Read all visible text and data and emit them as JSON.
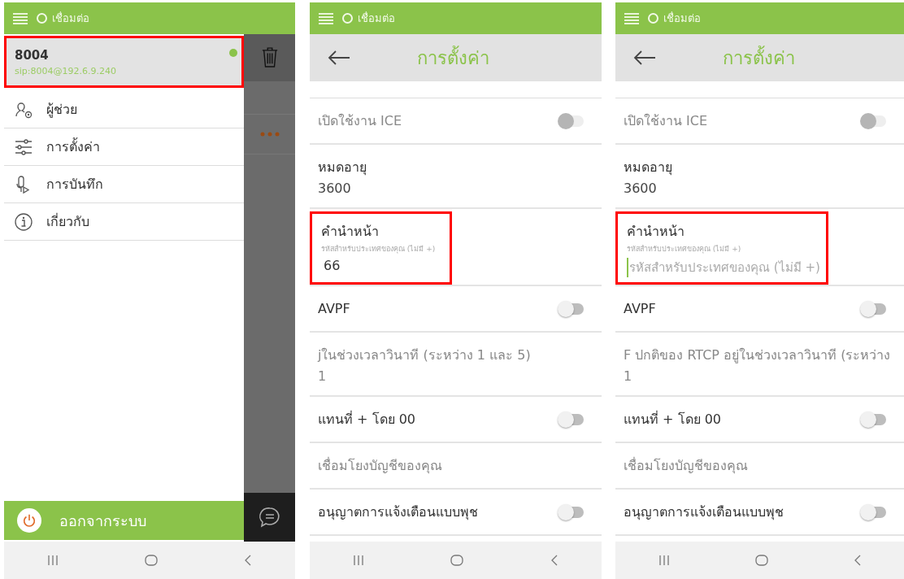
{
  "panels": [
    {
      "kind": "drawer",
      "status": {
        "label": "เชื่อมต่อ",
        "connected": true
      },
      "account": {
        "name": "8004",
        "address": "sip:8004@192.6.9.240",
        "online": true,
        "highlighted": true
      },
      "menu": [
        {
          "kind": "assistant",
          "label": "ผู้ช่วย"
        },
        {
          "kind": "settings",
          "label": "การตั้งค่า"
        },
        {
          "kind": "recordings",
          "label": "การบันทึก"
        },
        {
          "kind": "about",
          "label": "เกี่ยวกับ"
        }
      ],
      "logout": {
        "label": "ออกจากระบบ"
      }
    },
    {
      "kind": "settings",
      "status": {
        "label": "เชื่อมต่อ",
        "connected": true
      },
      "title": "การตั้งค่า",
      "settings": [
        {
          "kind": "toggle",
          "label": "เปิดใช้งาน ICE",
          "on": false,
          "disabled": true
        },
        {
          "kind": "value",
          "label": "หมดอายุ",
          "value": "3600",
          "disabled": false
        },
        {
          "kind": "field",
          "label": "คำนำหน้า",
          "hint": "รหัสสำหรับประเทศของคุณ (ไม่มี +)",
          "value": "66",
          "highlighted": true,
          "focused": false
        },
        {
          "kind": "toggle",
          "label": "AVPF",
          "on": false,
          "disabled": false
        },
        {
          "kind": "value",
          "label": "jในช่วงเวลาวินาที (ระหว่าง 1 และ 5)",
          "value": "1",
          "disabled": true
        },
        {
          "kind": "toggle",
          "label": "แทนที่ + โดย 00",
          "on": false,
          "disabled": false
        },
        {
          "kind": "link",
          "label": "เชื่อมโยงบัญชีของคุณ",
          "disabled": true
        },
        {
          "kind": "toggle",
          "label": "อนุญาตการแจ้งเตือนแบบพุช",
          "on": false,
          "disabled": false
        }
      ]
    },
    {
      "kind": "settings",
      "status": {
        "label": "เชื่อมต่อ",
        "connected": true
      },
      "title": "การตั้งค่า",
      "settings": [
        {
          "kind": "toggle",
          "label": "เปิดใช้งาน ICE",
          "on": false,
          "disabled": true
        },
        {
          "kind": "value",
          "label": "หมดอายุ",
          "value": "3600",
          "disabled": false
        },
        {
          "kind": "field",
          "label": "คำนำหน้า",
          "hint": "รหัสสำหรับประเทศของคุณ (ไม่มี +)",
          "placeholder": "รหัสสำหรับประเทศของคุณ (ไม่มี +)",
          "highlighted": true,
          "focused": true
        },
        {
          "kind": "toggle",
          "label": "AVPF",
          "on": false,
          "disabled": false
        },
        {
          "kind": "value",
          "label": "F ปกติของ RTCP อยู่ในช่วงเวลาวินาที (ระหว่าง",
          "value": "1",
          "disabled": true
        },
        {
          "kind": "toggle",
          "label": "แทนที่ + โดย 00",
          "on": false,
          "disabled": false
        },
        {
          "kind": "link",
          "label": "เชื่อมโยงบัญชีของคุณ",
          "disabled": true
        },
        {
          "kind": "toggle",
          "label": "อนุญาตการแจ้งเตือนแบบพุช",
          "on": false,
          "disabled": false
        }
      ]
    }
  ]
}
